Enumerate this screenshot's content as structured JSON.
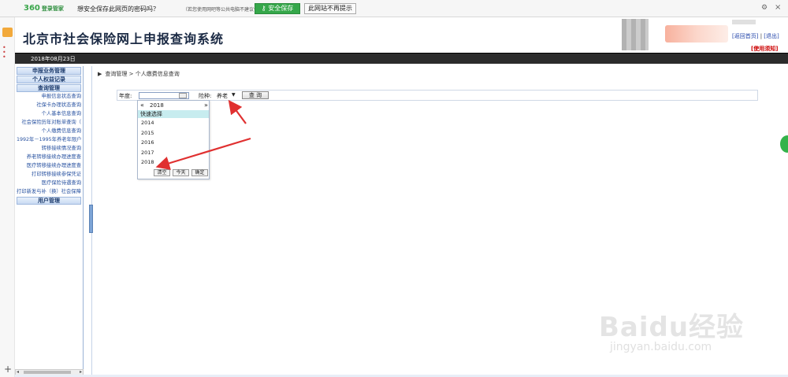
{
  "password_bar": {
    "logo": "360",
    "logo_sub": "登录管家",
    "question": "想安全保存此网页的密码吗？",
    "hint": "（若您使用网吧等公共电脑不建议保存）",
    "save_label": "安全保存",
    "never_label": "此网站不再提示",
    "gear_icon": "gear-icon",
    "close_icon": "close-icon"
  },
  "header": {
    "title": "北京市社会保险网上申报查询系统",
    "link_home": "[返回首页]",
    "link_logout": "[退出]",
    "link_help": "[使用须知]"
  },
  "date_bar": {
    "date": "2018年08月23日"
  },
  "sidebar": {
    "sections": [
      {
        "label": "申报业务管理"
      },
      {
        "label": "个人权益记录"
      },
      {
        "label": "查询管理",
        "items": [
          "申报信息状态查询",
          "社保卡办理状态查询",
          "个人基本信息查询",
          "社会保险历年对账单查询（",
          "个人缴费信息查询",
          "1992年－1995年养老年限户",
          "转移接续情况查询",
          "养老转移接续办理进度查",
          "医疗转移接续办理进度查",
          "打印转移接续参保凭证",
          "医疗保险待遇查询",
          "打印新发与补（换）社会保障卡"
        ]
      },
      {
        "label": "用户管理"
      }
    ]
  },
  "main": {
    "breadcrumb": "查询管理 > 个人缴费信息查询",
    "query": {
      "year_label": "年度:",
      "year_value": "",
      "type_label": "险种:",
      "type_value": "养老",
      "query_button": "查 询"
    },
    "datepicker": {
      "year": "2018",
      "quick_label": "快速选择",
      "options": [
        "2014",
        "2015",
        "2016",
        "2017",
        "2018"
      ],
      "clear": "清空",
      "today": "今天",
      "ok": "确定"
    }
  },
  "watermark": {
    "main": "Baidu经验",
    "sub": "jingyan.baidu.com"
  },
  "colors": {
    "accent_green": "#35a74a",
    "header_text": "#1b2a44",
    "date_bar": "#2c2c2c",
    "annotation_red": "#e03030",
    "quick_select_bg": "#c7ecef"
  }
}
